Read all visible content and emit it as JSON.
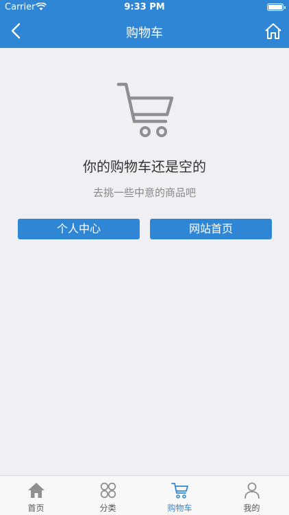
{
  "status_bar": {
    "carrier": "Carrier",
    "time": "9:33 PM"
  },
  "header": {
    "title": "购物车"
  },
  "empty_state": {
    "title": "你的购物车还是空的",
    "subtitle": "去挑一些中意的商品吧"
  },
  "buttons": {
    "personal_center": "个人中心",
    "site_home": "网站首页"
  },
  "tabbar": {
    "items": [
      {
        "label": "首页",
        "icon": "home-icon"
      },
      {
        "label": "分类",
        "icon": "category-icon"
      },
      {
        "label": "购物车",
        "icon": "cart-icon",
        "active": true
      },
      {
        "label": "我的",
        "icon": "user-icon"
      }
    ]
  },
  "colors": {
    "accent": "#2f86d4",
    "background": "#efeff4",
    "tabbar_bg": "#f8f8f8"
  }
}
